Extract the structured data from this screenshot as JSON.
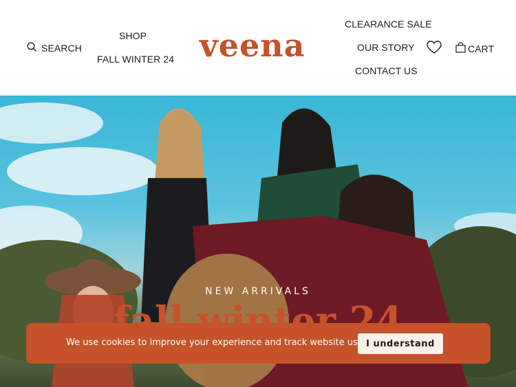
{
  "header": {
    "search_label": "SEARCH",
    "shop_label": "SHOP",
    "fall_winter_label": "FALL WINTER 24",
    "logo_text": "veena",
    "clearance_label": "CLEARANCE SALE",
    "our_story_label": "OUR STORY",
    "contact_label": "CONTACT US",
    "cart_label": "CART",
    "icons": {
      "search": "search-icon",
      "wishlist": "heart-icon",
      "cart": "shopping-bag-icon"
    }
  },
  "hero": {
    "kicker": "NEW ARRIVALS",
    "title": "fall winter 24"
  },
  "cookie_banner": {
    "message": "We use cookies to improve your experience and track website usage.",
    "button_label": "I understand"
  },
  "colors": {
    "brand": "#c5522b",
    "button_bg": "#fbf3ea",
    "sky": "#3ab6d6"
  }
}
